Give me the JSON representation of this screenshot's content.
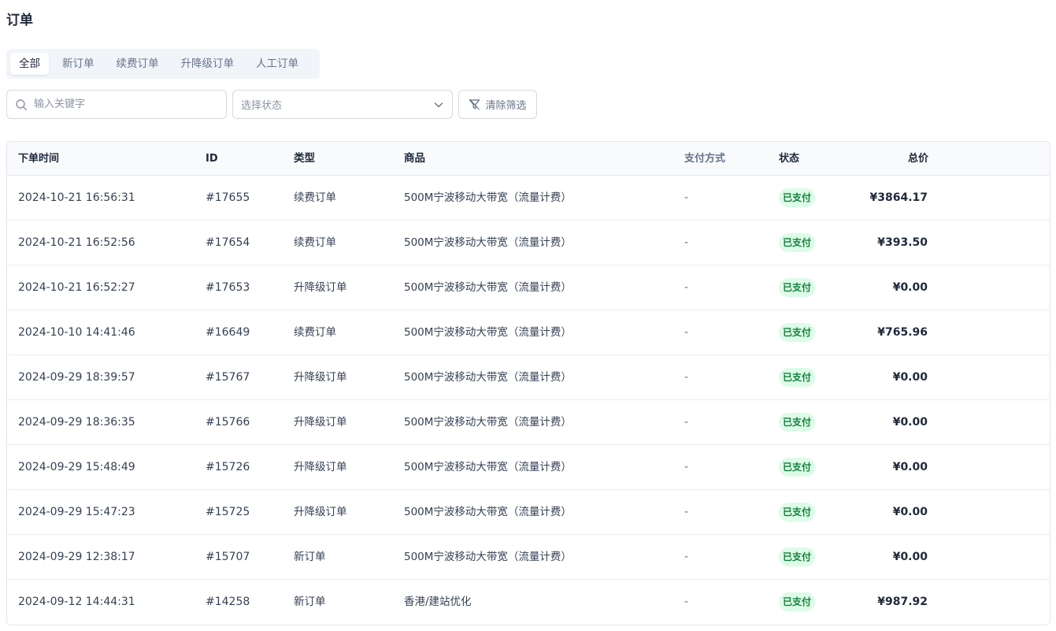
{
  "page": {
    "title": "订单"
  },
  "tabs": [
    {
      "label": "全部",
      "active": true
    },
    {
      "label": "新订单",
      "active": false
    },
    {
      "label": "续费订单",
      "active": false
    },
    {
      "label": "升降级订单",
      "active": false
    },
    {
      "label": "人工订单",
      "active": false
    }
  ],
  "filters": {
    "search_placeholder": "输入关键字",
    "status_placeholder": "选择状态",
    "clear_label": "清除筛选"
  },
  "table": {
    "columns": {
      "time": "下单时间",
      "id": "ID",
      "type": "类型",
      "product": "商品",
      "payment": "支付方式",
      "status": "状态",
      "total": "总价"
    },
    "rows": [
      {
        "time": "2024-10-21 16:56:31",
        "id": "#17655",
        "type": "续费订单",
        "product": "500M宁波移动大带宽（流量计费）",
        "payment": "-",
        "status": "已支付",
        "total": "¥3864.17"
      },
      {
        "time": "2024-10-21 16:52:56",
        "id": "#17654",
        "type": "续费订单",
        "product": "500M宁波移动大带宽（流量计费）",
        "payment": "-",
        "status": "已支付",
        "total": "¥393.50"
      },
      {
        "time": "2024-10-21 16:52:27",
        "id": "#17653",
        "type": "升降级订单",
        "product": "500M宁波移动大带宽（流量计费）",
        "payment": "-",
        "status": "已支付",
        "total": "¥0.00"
      },
      {
        "time": "2024-10-10 14:41:46",
        "id": "#16649",
        "type": "续费订单",
        "product": "500M宁波移动大带宽（流量计费）",
        "payment": "-",
        "status": "已支付",
        "total": "¥765.96"
      },
      {
        "time": "2024-09-29 18:39:57",
        "id": "#15767",
        "type": "升降级订单",
        "product": "500M宁波移动大带宽（流量计费）",
        "payment": "-",
        "status": "已支付",
        "total": "¥0.00"
      },
      {
        "time": "2024-09-29 18:36:35",
        "id": "#15766",
        "type": "升降级订单",
        "product": "500M宁波移动大带宽（流量计费）",
        "payment": "-",
        "status": "已支付",
        "total": "¥0.00"
      },
      {
        "time": "2024-09-29 15:48:49",
        "id": "#15726",
        "type": "升降级订单",
        "product": "500M宁波移动大带宽（流量计费）",
        "payment": "-",
        "status": "已支付",
        "total": "¥0.00"
      },
      {
        "time": "2024-09-29 15:47:23",
        "id": "#15725",
        "type": "升降级订单",
        "product": "500M宁波移动大带宽（流量计费）",
        "payment": "-",
        "status": "已支付",
        "total": "¥0.00"
      },
      {
        "time": "2024-09-29 12:38:17",
        "id": "#15707",
        "type": "新订单",
        "product": "500M宁波移动大带宽（流量计费）",
        "payment": "-",
        "status": "已支付",
        "total": "¥0.00"
      },
      {
        "time": "2024-09-12 14:44:31",
        "id": "#14258",
        "type": "新订单",
        "product": "香港/建站优化",
        "payment": "-",
        "status": "已支付",
        "total": "¥987.92"
      }
    ]
  },
  "colors": {
    "paid_badge_bg": "#dcfce7",
    "paid_badge_text": "#15803d"
  }
}
